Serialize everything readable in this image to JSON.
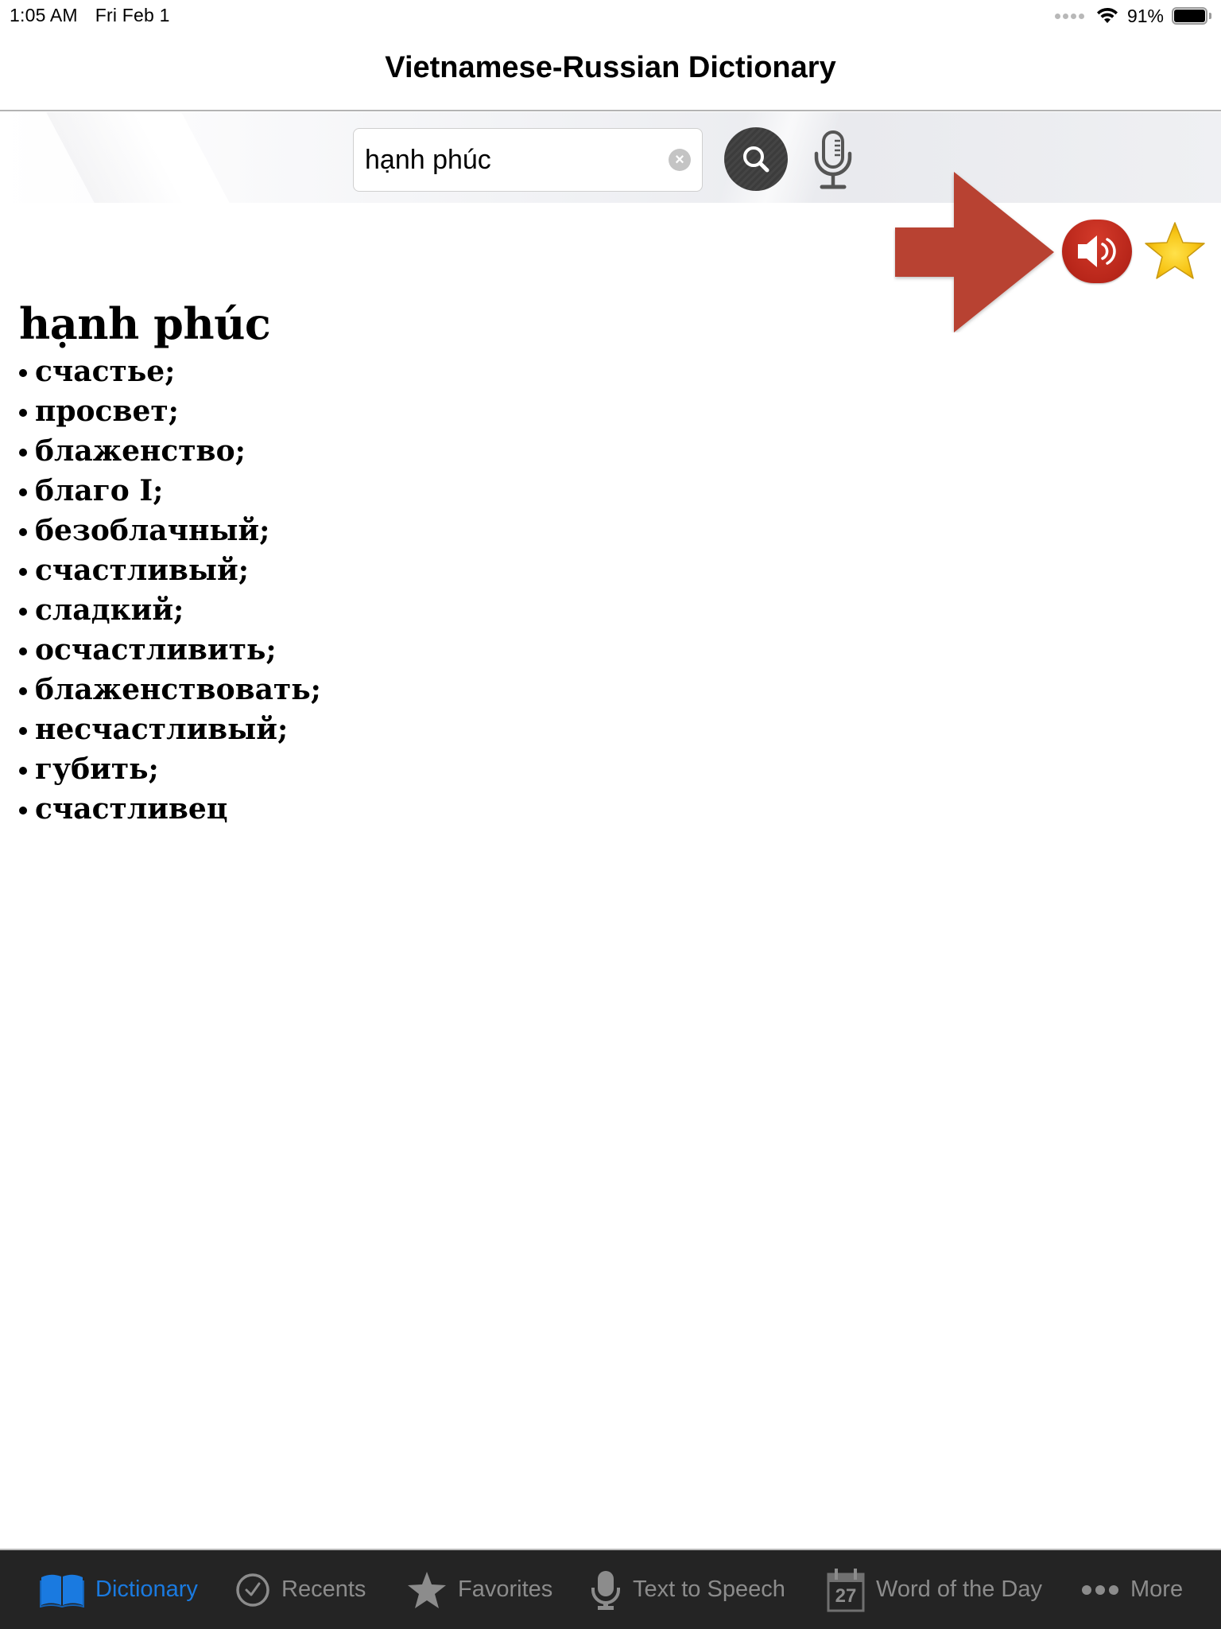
{
  "status_bar": {
    "time": "1:05 AM",
    "date": "Fri Feb 1",
    "battery_percent": "91%",
    "icons": [
      "signal-dots-icon",
      "wifi-icon",
      "battery-icon"
    ]
  },
  "nav": {
    "title": "Vietnamese-Russian Dictionary"
  },
  "search": {
    "value": "hạnh phúc",
    "placeholder": "",
    "clear_icon": "×",
    "search_icon": "search-icon",
    "mic_icon": "microphone-icon"
  },
  "actions": {
    "annotation": "red-arrow-pointing-to-speaker",
    "speak_icon": "speaker-icon",
    "favorite_icon": "star-icon"
  },
  "entry": {
    "headword": "hạnh phúc",
    "translations": [
      "счастье;",
      "просвет;",
      "блаженство;",
      "благо I;",
      "безоблачный;",
      "счастливый;",
      "сладкий;",
      "осчастливить;",
      "блаженствовать;",
      "несчастливый;",
      "губить;",
      "счастливец"
    ]
  },
  "tab_bar": {
    "active_color": "#1a7ae0",
    "inactive_color": "#8c8c8c",
    "tabs": [
      {
        "label": "Dictionary",
        "icon": "book-icon",
        "active": true
      },
      {
        "label": "Recents",
        "icon": "clock-check-icon",
        "active": false
      },
      {
        "label": "Favorites",
        "icon": "star-icon",
        "active": false
      },
      {
        "label": "Text to Speech",
        "icon": "microphone-icon",
        "active": false
      },
      {
        "label": "Word of the Day",
        "icon": "calendar-icon",
        "active": false,
        "badge": "27"
      },
      {
        "label": "More",
        "icon": "more-dots-icon",
        "active": false
      }
    ]
  }
}
